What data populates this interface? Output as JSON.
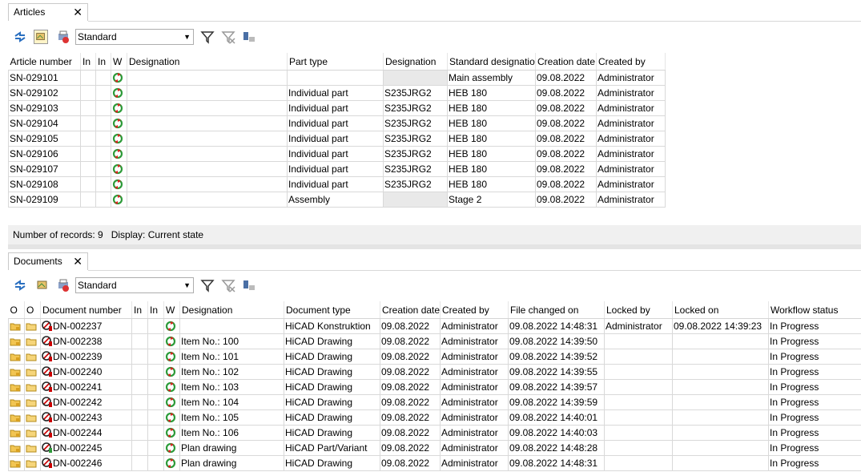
{
  "articles": {
    "tab_label": "Articles",
    "close_glyph": "✕",
    "view_select": "Standard",
    "columns": [
      "Article number",
      "In",
      "In",
      "W",
      "Designation",
      "Part type",
      "Designation",
      "Standard designation",
      "Creation date",
      "Created by"
    ],
    "rows": [
      [
        "SN-029101",
        "",
        "",
        "",
        "",
        "",
        "",
        "Main assembly",
        "09.08.2022",
        "Administrator"
      ],
      [
        "SN-029102",
        "",
        "",
        "",
        "",
        "Individual part",
        "S235JRG2",
        "HEB 180",
        "09.08.2022",
        "Administrator"
      ],
      [
        "SN-029103",
        "",
        "",
        "",
        "",
        "Individual part",
        "S235JRG2",
        "HEB 180",
        "09.08.2022",
        "Administrator"
      ],
      [
        "SN-029104",
        "",
        "",
        "",
        "",
        "Individual part",
        "S235JRG2",
        "HEB 180",
        "09.08.2022",
        "Administrator"
      ],
      [
        "SN-029105",
        "",
        "",
        "",
        "",
        "Individual part",
        "S235JRG2",
        "HEB 180",
        "09.08.2022",
        "Administrator"
      ],
      [
        "SN-029106",
        "",
        "",
        "",
        "",
        "Individual part",
        "S235JRG2",
        "HEB 180",
        "09.08.2022",
        "Administrator"
      ],
      [
        "SN-029107",
        "",
        "",
        "",
        "",
        "Individual part",
        "S235JRG2",
        "HEB 180",
        "09.08.2022",
        "Administrator"
      ],
      [
        "SN-029108",
        "",
        "",
        "",
        "",
        "Individual part",
        "S235JRG2",
        "HEB 180",
        "09.08.2022",
        "Administrator"
      ],
      [
        "SN-029109",
        "",
        "",
        "",
        "",
        "Assembly",
        "",
        "Stage 2",
        "09.08.2022",
        "Administrator"
      ]
    ],
    "status": "Number of records: 9   Display: Current state"
  },
  "documents": {
    "tab_label": "Documents",
    "close_glyph": "✕",
    "view_select": "Standard",
    "columns": [
      "O",
      "O",
      "Document number",
      "In",
      "In",
      "W",
      "Designation",
      "Document type",
      "Creation date",
      "Created by",
      "File changed on",
      "Locked by",
      "Locked on",
      "Workflow status"
    ],
    "rows": [
      [
        "DN-002237",
        "",
        "HiCAD Konstruktion",
        "09.08.2022",
        "Administrator",
        "09.08.2022 14:48:31",
        "Administrator",
        "09.08.2022 14:39:23",
        "In Progress"
      ],
      [
        "DN-002238",
        "Item No.: 100",
        "HiCAD Drawing",
        "09.08.2022",
        "Administrator",
        "09.08.2022 14:39:50",
        "",
        "",
        "In Progress"
      ],
      [
        "DN-002239",
        "Item No.: 101",
        "HiCAD Drawing",
        "09.08.2022",
        "Administrator",
        "09.08.2022 14:39:52",
        "",
        "",
        "In Progress"
      ],
      [
        "DN-002240",
        "Item No.: 102",
        "HiCAD Drawing",
        "09.08.2022",
        "Administrator",
        "09.08.2022 14:39:55",
        "",
        "",
        "In Progress"
      ],
      [
        "DN-002241",
        "Item No.: 103",
        "HiCAD Drawing",
        "09.08.2022",
        "Administrator",
        "09.08.2022 14:39:57",
        "",
        "",
        "In Progress"
      ],
      [
        "DN-002242",
        "Item No.: 104",
        "HiCAD Drawing",
        "09.08.2022",
        "Administrator",
        "09.08.2022 14:39:59",
        "",
        "",
        "In Progress"
      ],
      [
        "DN-002243",
        "Item No.: 105",
        "HiCAD Drawing",
        "09.08.2022",
        "Administrator",
        "09.08.2022 14:40:01",
        "",
        "",
        "In Progress"
      ],
      [
        "DN-002244",
        "Item No.: 106",
        "HiCAD Drawing",
        "09.08.2022",
        "Administrator",
        "09.08.2022 14:40:03",
        "",
        "",
        "In Progress"
      ],
      [
        "DN-002245",
        "Plan drawing",
        "HiCAD Part/Variant",
        "09.08.2022",
        "Administrator",
        "09.08.2022 14:48:28",
        "",
        "",
        "In Progress"
      ],
      [
        "DN-002246",
        "Plan drawing",
        "HiCAD Drawing",
        "09.08.2022",
        "Administrator",
        "09.08.2022 14:48:31",
        "",
        "",
        "In Progress"
      ]
    ]
  },
  "icons": [
    "refresh-icon",
    "view-icon",
    "print-icon",
    "filter-icon",
    "clear-filter-icon",
    "column-settings-icon",
    "workflow-icon",
    "folder-lock-icon",
    "folder-open-icon",
    "doc-status-icon"
  ]
}
